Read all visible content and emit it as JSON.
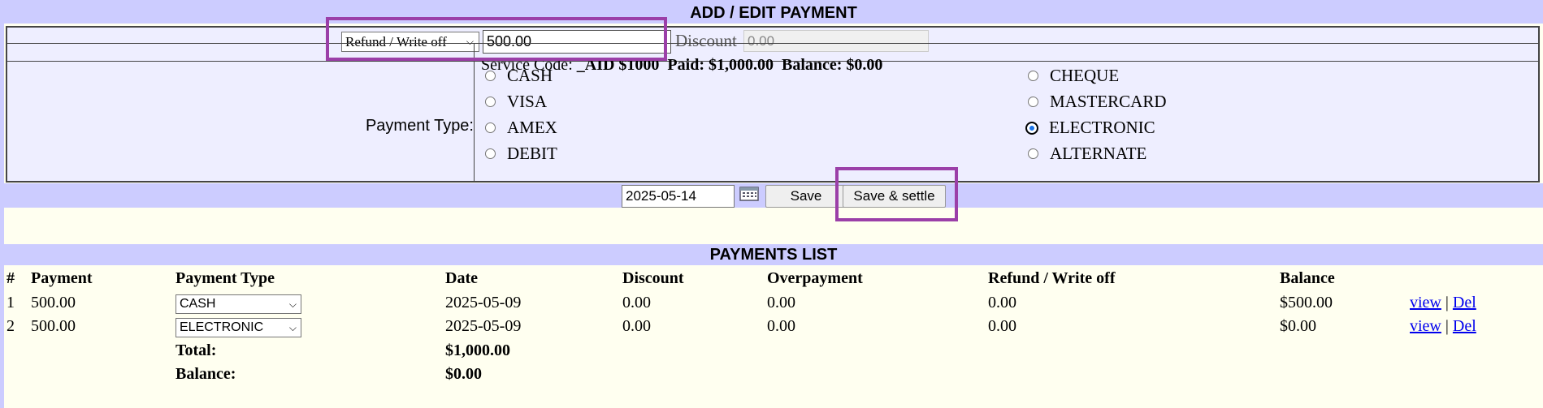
{
  "add_edit": {
    "title": "ADD / EDIT PAYMENT",
    "entry_type_selected": "Refund / Write off",
    "amount_value": "500.00",
    "discount_label": "Discount",
    "discount_value": "0.00",
    "service_code_label": "Service Code:",
    "service_code_value": "_AID $1000",
    "paid_label": "Paid:",
    "paid_value": "$1,000.00",
    "balance_label": "Balance:",
    "balance_value": "$0.00",
    "payment_type_label": "Payment Type:",
    "payment_types": [
      {
        "label": "CASH",
        "selected": false
      },
      {
        "label": "CHEQUE",
        "selected": false
      },
      {
        "label": "VISA",
        "selected": false
      },
      {
        "label": "MASTERCARD",
        "selected": false
      },
      {
        "label": "AMEX",
        "selected": false
      },
      {
        "label": "ELECTRONIC",
        "selected": true
      },
      {
        "label": "DEBIT",
        "selected": false
      },
      {
        "label": "ALTERNATE",
        "selected": false
      }
    ],
    "date_value": "2025-05-14",
    "save_label": "Save",
    "save_settle_label": "Save & settle"
  },
  "payments_list": {
    "title": "PAYMENTS LIST",
    "columns": [
      "#",
      "Payment",
      "Payment Type",
      "Date",
      "Discount",
      "Overpayment",
      "Refund / Write off",
      "Balance"
    ],
    "rows": [
      {
        "num": "1",
        "payment": "500.00",
        "type": "CASH",
        "date": "2025-05-09",
        "discount": "0.00",
        "overpayment": "0.00",
        "refund": "0.00",
        "balance": "$500.00",
        "view": "view",
        "sep": "|",
        "del": "Del"
      },
      {
        "num": "2",
        "payment": "500.00",
        "type": "ELECTRONIC",
        "date": "2025-05-09",
        "discount": "0.00",
        "overpayment": "0.00",
        "refund": "0.00",
        "balance": "$0.00",
        "view": "view",
        "sep": "|",
        "del": "Del"
      }
    ],
    "total_label": "Total:",
    "total_value": "$1,000.00",
    "balance_label": "Balance:",
    "balance_value": "$0.00"
  },
  "colors": {
    "header_bar": "#ccccff",
    "form_bg": "#eeeeff",
    "page_bg": "#fffff0",
    "highlight": "#9b3fa8",
    "radio_selected": "#1a73e8",
    "link": "#0000ee"
  }
}
